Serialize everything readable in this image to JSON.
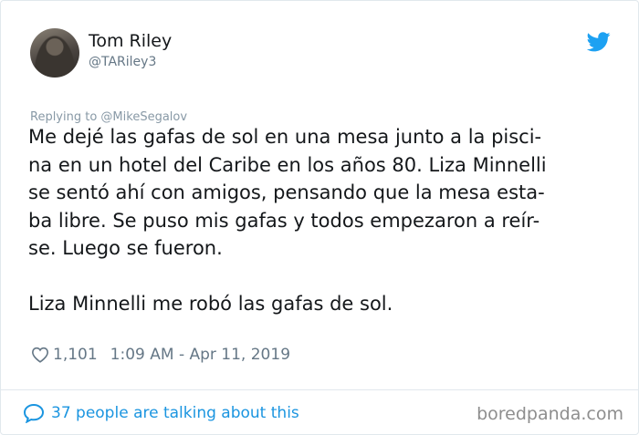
{
  "author": {
    "name": "Tom Riley",
    "handle": "@TARiley3"
  },
  "reply": {
    "text": "Replying to @MikeSegalov"
  },
  "tweet": {
    "lines": [
      "Me dejé las gafas de sol en una mesa junto a la pisci-",
      "na en un hotel del Caribe en los años 80. Liza Minnelli",
      "se sentó ahí con amigos, pensando que la mesa esta-",
      "ba libre. Se puso mis gafas y todos empezaron a reír-",
      "se. Luego se fueron."
    ],
    "closing": "Liza Minnelli me robó las gafas de sol."
  },
  "meta": {
    "likes": "1,101",
    "timestamp": "1:09 AM - Apr 11, 2019"
  },
  "footer": {
    "talking": "37 people are talking about this",
    "watermark": "boredpanda.com"
  },
  "icons": {
    "brand": "twitter-bird-icon",
    "like": "heart-icon",
    "conversation": "speech-bubble-icon"
  },
  "colors": {
    "twitter_blue": "#1da1f2",
    "link_blue": "#1b95e0",
    "secondary_text": "#657786",
    "primary_text": "#14171a"
  }
}
